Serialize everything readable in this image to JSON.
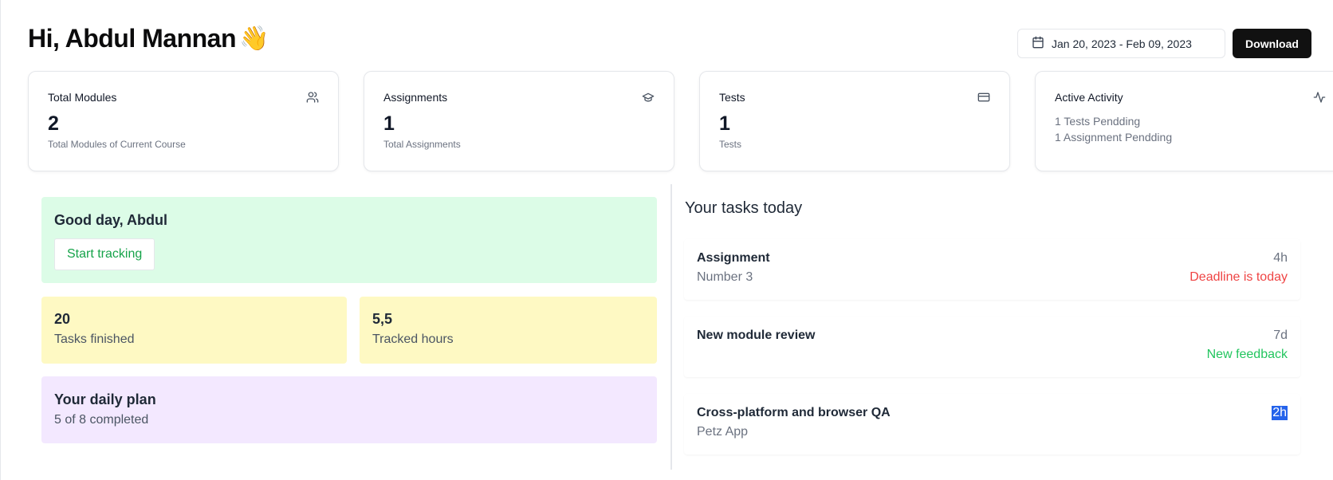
{
  "header": {
    "greeting": "Hi, Abdul Mannan",
    "wave_emoji": "👋",
    "date_range": "Jan 20, 2023 - Feb 09, 2023",
    "download_label": "Download"
  },
  "stats": [
    {
      "title": "Total Modules",
      "value": "2",
      "desc": "Total Modules of Current Course",
      "icon": "users-icon"
    },
    {
      "title": "Assignments",
      "value": "1",
      "desc": "Total Assignments",
      "icon": "graduation-cap-icon"
    },
    {
      "title": "Tests",
      "value": "1",
      "desc": "Tests",
      "icon": "credit-card-icon"
    },
    {
      "title": "Active Activity",
      "lines": [
        "1 Tests Pendding",
        "1 Assignment Pendding"
      ],
      "icon": "activity-icon"
    }
  ],
  "left": {
    "good_day": "Good day, Abdul",
    "start_tracking": "Start tracking",
    "tasks_finished": {
      "value": "20",
      "label": "Tasks finished"
    },
    "tracked_hours": {
      "value": "5,5",
      "label": "Tracked hours"
    },
    "daily_plan": {
      "title": "Your daily plan",
      "sub": "5 of 8 completed"
    }
  },
  "right": {
    "title": "Your tasks today",
    "tasks": [
      {
        "title": "Assignment",
        "sub": "Number 3",
        "time": "4h",
        "status": "Deadline is today",
        "status_color": "#ef4444"
      },
      {
        "title": "New module review",
        "sub": "",
        "time": "7d",
        "status": "New feedback",
        "status_color": "#22c55e"
      },
      {
        "title": "Cross-platform and browser QA",
        "sub": "Petz App",
        "time": "2h",
        "status": "",
        "status_color": ""
      }
    ]
  },
  "colors": {
    "green_card": "#dcfce7",
    "yellow_card": "#fef9c3",
    "purple_card": "#f3e8ff",
    "primary_button": "#111111",
    "selection": "#2563eb"
  }
}
